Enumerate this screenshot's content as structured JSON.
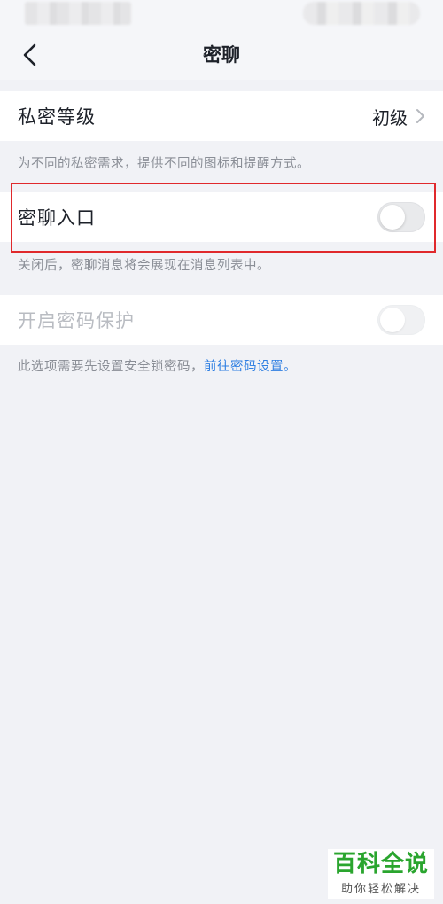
{
  "nav": {
    "title": "密聊",
    "back_icon": "chevron-left-icon"
  },
  "settings": {
    "privacy_level": {
      "label": "私密等级",
      "value": "初级"
    },
    "privacy_level_hint": "为不同的私密需求，提供不同的图标和提醒方式。",
    "secret_chat_entry": {
      "label": "密聊入口",
      "enabled": false
    },
    "secret_chat_entry_hint": "关闭后，密聊消息将会展现在消息列表中。",
    "password_protection": {
      "label": "开启密码保护",
      "enabled": false,
      "disabled": true
    },
    "password_hint": {
      "text": "此选项需要先设置安全锁密码，",
      "link": "前往密码设置。"
    }
  },
  "watermark": {
    "top": "百科全说",
    "bottom": "助你轻松解决"
  },
  "colors": {
    "background": "#f1f2f6",
    "text_primary": "#1d2129",
    "text_hint": "#8a8e96",
    "link": "#2f7fe2",
    "highlight": "#e0292c",
    "watermark_green": "#2aa52e"
  }
}
